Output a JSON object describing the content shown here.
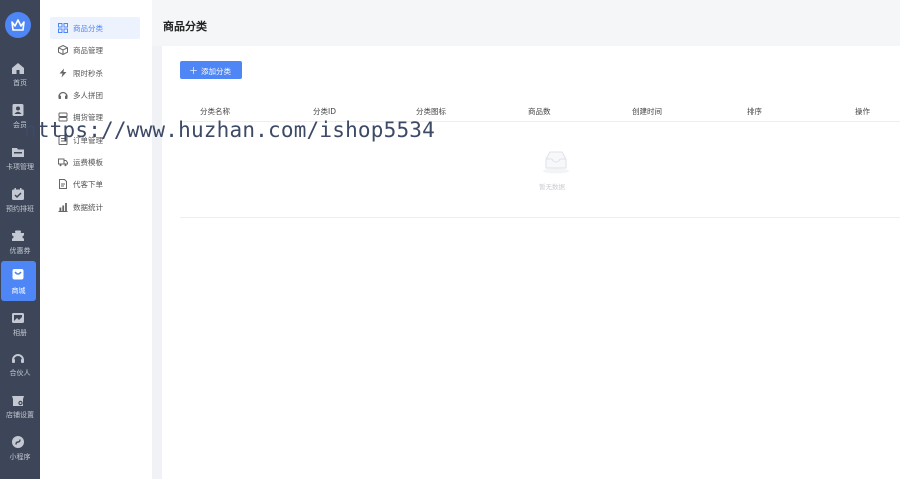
{
  "rail": {
    "items": [
      {
        "label": "首页",
        "icon": "home-icon"
      },
      {
        "label": "会员",
        "icon": "member-icon"
      },
      {
        "label": "卡项管理",
        "icon": "card-icon"
      },
      {
        "label": "预约排班",
        "icon": "calendar-icon"
      },
      {
        "label": "优惠券",
        "icon": "coupon-icon"
      },
      {
        "label": "商城",
        "icon": "mall-icon"
      },
      {
        "label": "相册",
        "icon": "album-icon"
      },
      {
        "label": "合伙人",
        "icon": "partner-icon"
      },
      {
        "label": "店铺设置",
        "icon": "store-settings-icon"
      },
      {
        "label": "小程序",
        "icon": "mini-program-icon"
      }
    ],
    "active": "商城",
    "accent": "#4f86f5",
    "background": "#3d4658"
  },
  "submenu": {
    "items": [
      {
        "label": "商品分类",
        "icon": "grid-icon"
      },
      {
        "label": "商品管理",
        "icon": "box-icon"
      },
      {
        "label": "限时秒杀",
        "icon": "flash-icon"
      },
      {
        "label": "多人拼团",
        "icon": "group-icon"
      },
      {
        "label": "拥货管理",
        "icon": "stack-icon"
      },
      {
        "label": "订单管理",
        "icon": "order-icon"
      },
      {
        "label": "运费模板",
        "icon": "truck-icon"
      },
      {
        "label": "代客下单",
        "icon": "document-icon"
      },
      {
        "label": "数据统计",
        "icon": "chart-icon"
      }
    ],
    "active": "商品分类"
  },
  "page": {
    "title": "商品分类",
    "add_button": "添加分类",
    "add_icon": "＋"
  },
  "table": {
    "columns": [
      "分类名称",
      "分类ID",
      "分类图标",
      "商品数",
      "创建时间",
      "排序",
      "操作"
    ],
    "rows": [],
    "empty_text": "暂无数据"
  },
  "watermark": "https://www.huzhan.com/ishop5534"
}
